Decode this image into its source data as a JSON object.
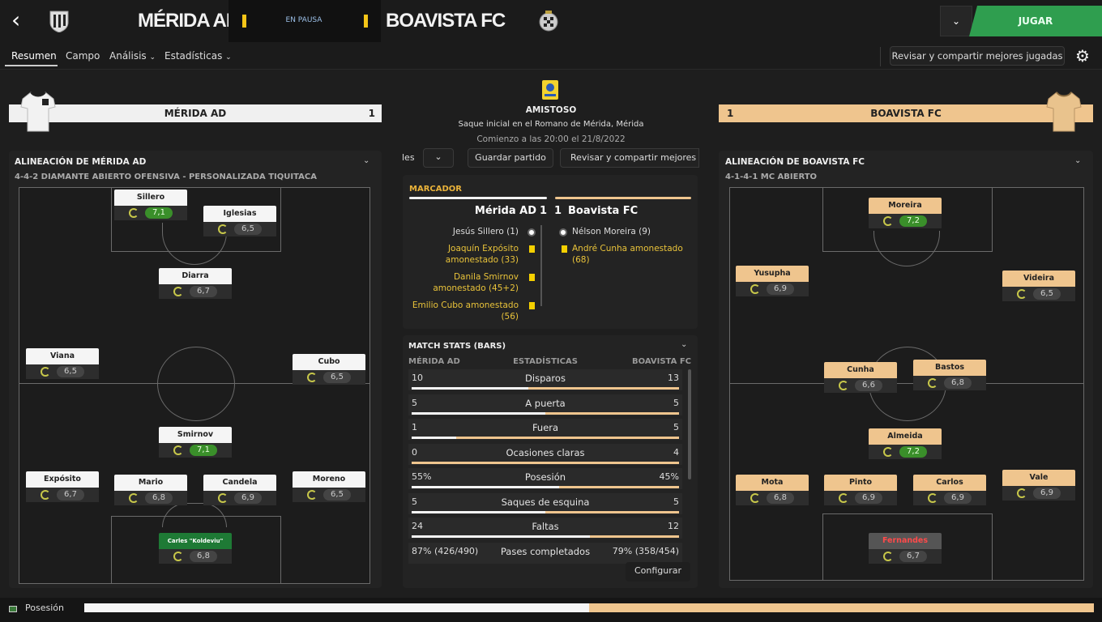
{
  "header": {
    "home_team": "MÉRIDA AD",
    "away_team": "BOAVISTA FC",
    "status": "EN PAUSA",
    "play_button": "JUGAR",
    "home_crest_icon": "merida-crest-icon",
    "away_crest_icon": "boavista-crest-icon"
  },
  "nav": {
    "tabs": [
      "Resumen",
      "Campo",
      "Análisis",
      "Estadísticas"
    ],
    "active": "Resumen",
    "share_label": "Revisar y compartir mejores jugadas"
  },
  "home_panel": {
    "team_bar": "MÉRIDA AD",
    "score": "1",
    "lineup_title": "ALINEACIÓN DE MÉRIDA AD",
    "formation": "4-4-2 DIAMANTE ABIERTO OFENSIVA - PERSONALIZADA TIQUITACA",
    "players": [
      {
        "name": "Sillero",
        "rating": "7,1",
        "good": true
      },
      {
        "name": "Iglesias",
        "rating": "6,5",
        "good": false
      },
      {
        "name": "Diarra",
        "rating": "6,7",
        "good": false
      },
      {
        "name": "Viana",
        "rating": "6,5",
        "good": false
      },
      {
        "name": "Cubo",
        "rating": "6,5",
        "good": false
      },
      {
        "name": "Smirnov",
        "rating": "7,1",
        "good": true
      },
      {
        "name": "Expósito",
        "rating": "6,7",
        "good": false
      },
      {
        "name": "Mario",
        "rating": "6,8",
        "good": false
      },
      {
        "name": "Candela",
        "rating": "6,9",
        "good": false
      },
      {
        "name": "Moreno",
        "rating": "6,5",
        "good": false
      },
      {
        "name": "Carles \"Koldeviu\" Santaló",
        "rating": "6,8",
        "good": false
      }
    ]
  },
  "away_panel": {
    "team_bar": "BOAVISTA FC",
    "score": "1",
    "lineup_title": "ALINEACIÓN DE BOAVISTA FC",
    "formation": "4-1-4-1 MC ABIERTO",
    "players": [
      {
        "name": "Moreira",
        "rating": "7,2",
        "good": true
      },
      {
        "name": "Yusupha",
        "rating": "6,9",
        "good": false
      },
      {
        "name": "Videira",
        "rating": "6,5",
        "good": false
      },
      {
        "name": "Cunha",
        "rating": "6,6",
        "good": false
      },
      {
        "name": "Bastos",
        "rating": "6,8",
        "good": false
      },
      {
        "name": "Almeida",
        "rating": "7,2",
        "good": true
      },
      {
        "name": "Mota",
        "rating": "6,8",
        "good": false
      },
      {
        "name": "Pinto",
        "rating": "6,9",
        "good": false
      },
      {
        "name": "Carlos",
        "rating": "6,9",
        "good": false
      },
      {
        "name": "Vale",
        "rating": "6,9",
        "good": false
      },
      {
        "name": "Fernandes",
        "rating": "6,7",
        "good": false
      }
    ]
  },
  "center": {
    "competition": "AMISTOSO",
    "venue": "Saque inicial en el Romano de Mérida, Mérida",
    "kickoff": "Comienzo a las 20:00 el 21/8/2022",
    "toolbar_left": "les",
    "save_match": "Guardar partido",
    "share_truncated": "Revisar y compartir mejores ju",
    "scoreboard_title": "MARCADOR",
    "score_line": {
      "home": "Mérida AD",
      "home_goals": "1",
      "away_goals": "1",
      "away": "Boavista FC"
    },
    "home_events": [
      "Jesús Sillero (1)",
      "Joaquín Expósito amonestado (33)",
      "Danila Smirnov amonestado (45+2)",
      "Emilio Cubo amonestado (56)"
    ],
    "away_events": [
      "Nélson Moreira (9)",
      "André Cunha amonestado (68)"
    ],
    "stats_title": "MATCH STATS (BARS)",
    "stats_col_home": "MÉRIDA AD",
    "stats_col_mid": "ESTADÍSTICAS",
    "stats_col_away": "BOAVISTA FC",
    "stats": [
      {
        "label": "Disparos",
        "home": "10",
        "away": "13",
        "home_share": 0.435
      },
      {
        "label": "A puerta",
        "home": "5",
        "away": "5",
        "home_share": 0.5
      },
      {
        "label": "Fuera",
        "home": "1",
        "away": "5",
        "home_share": 0.167
      },
      {
        "label": "Ocasiones claras",
        "home": "0",
        "away": "4",
        "home_share": 0.0
      },
      {
        "label": "Posesión",
        "home": "55%",
        "away": "45%",
        "home_share": 0.55
      },
      {
        "label": "Saques de esquina",
        "home": "5",
        "away": "5",
        "home_share": 0.5
      },
      {
        "label": "Faltas",
        "home": "24",
        "away": "12",
        "home_share": 0.667
      },
      {
        "label": "Pases completados",
        "home": "87% (426/490)",
        "away": "79% (358/454)",
        "home_share": 0.5
      }
    ],
    "configure": "Configurar"
  },
  "footer": {
    "label": "Posesión",
    "home_share": 0.5
  }
}
